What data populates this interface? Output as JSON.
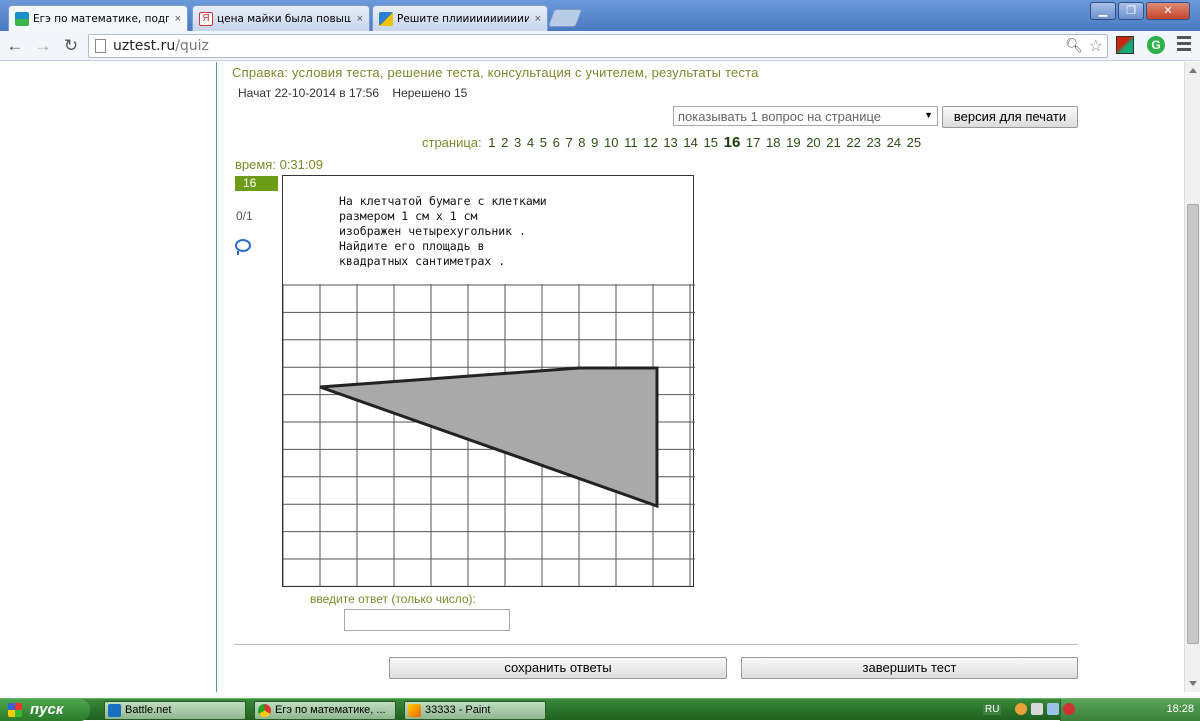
{
  "browser": {
    "tabs": [
      {
        "label": "Егэ по математике, подгот",
        "favicon": "uztest-favicon-icon",
        "active": true
      },
      {
        "label": "цена майки была повышен",
        "favicon": "yandex-favicon-icon",
        "active": false
      },
      {
        "label": "Решите плиииииииииииих",
        "favicon": "znanija-favicon-icon",
        "active": false
      }
    ],
    "close_glyph": "×",
    "url_host": "uztest.ru",
    "url_path": "/quiz"
  },
  "quiz": {
    "help_label": "Справка:",
    "help_links": "условия теста, решение теста, консультация с учителем, результаты теста",
    "started": "Начат 22-10-2014 в 17:56",
    "unsolved": "Нерешено 15",
    "per_page_select": "показывать 1 вопрос на странице",
    "print_button": "версия для печати",
    "pages_label": "страница:",
    "pages": [
      "1",
      "2",
      "3",
      "4",
      "5",
      "6",
      "7",
      "8",
      "9",
      "10",
      "11",
      "12",
      "13",
      "14",
      "15",
      "16",
      "17",
      "18",
      "19",
      "20",
      "21",
      "22",
      "23",
      "24",
      "25"
    ],
    "current_page": "16",
    "timer": "время: 0:31:09",
    "question_number": "16",
    "score": "0/1",
    "task_text": "На клетчатой бумаге с клетками\nразмером 1 см x 1 см\nизображен четырехугольник .\nНайдите его площадь в\nквадратных сантиметрах .",
    "answer_label": "введите ответ (только число):",
    "answer_value": "",
    "save_button": "сохранить ответы",
    "finish_button": "завершить тест"
  },
  "taskbar": {
    "start_label": "пуск",
    "items": [
      {
        "label": "Battle.net",
        "icon": "battlenet-icon"
      },
      {
        "label": "Егэ по математике, ...",
        "icon": "chrome-icon"
      },
      {
        "label": "33333 - Paint",
        "icon": "paint-icon"
      }
    ],
    "lang": "RU",
    "clock": "18:28"
  },
  "colors": {
    "accent_green": "#7a8a2a",
    "badge_green": "#6d9c16",
    "shape_fill": "#a9a9a9"
  }
}
